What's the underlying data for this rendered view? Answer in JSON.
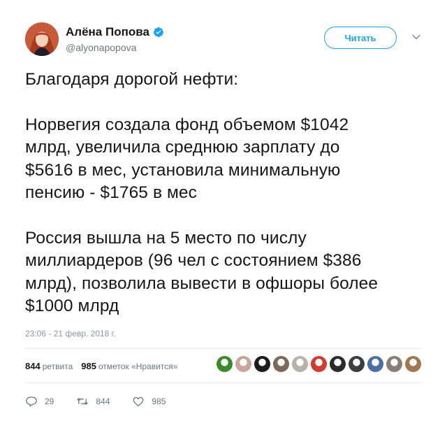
{
  "author": {
    "display_name": "Алёна Попова",
    "handle": "@alyonapopova",
    "verified": true,
    "avatar_icon": "user-avatar"
  },
  "follow_button": {
    "label": "Читать"
  },
  "menu": {
    "icon": "chevron-down-icon"
  },
  "tweet": {
    "paragraphs": [
      "Благодаря дорогой нефти:",
      "Норвегия создала фонд объемом $1042\nмлрд, увеличила среднюю зарплату до\n$5616 в мес, установила минимальную\nпенсию - $1765 в мес",
      "Россия вышла на 5 место по числу\nмиллиардеров (96 чел с состоянием $386\nмлрд), позволила вывести в офшоры более\n$1000 млрд"
    ],
    "timestamp": "23:06 - 21 февр. 2018 г."
  },
  "stats": {
    "retweets_count": "844",
    "retweets_label": "ретвита",
    "likes_count": "985",
    "likes_label": "отметок «Нравится»"
  },
  "likers": [
    {
      "icon": "liker-avatar",
      "color": "#3a8a2a"
    },
    {
      "icon": "liker-avatar",
      "color": "#c9a59a"
    },
    {
      "icon": "liker-avatar",
      "color": "#1c1c1c"
    },
    {
      "icon": "liker-avatar",
      "color": "#7d6a5c"
    },
    {
      "icon": "liker-avatar",
      "color": "#b8b2a8"
    },
    {
      "icon": "liker-avatar",
      "color": "#d43a2f"
    },
    {
      "icon": "liker-avatar",
      "color": "#2b2b2b"
    },
    {
      "icon": "liker-avatar",
      "color": "#3e3e3e"
    },
    {
      "icon": "liker-avatar",
      "color": "#4a6fa5"
    },
    {
      "icon": "liker-avatar",
      "color": "#8a7e74"
    },
    {
      "icon": "liker-avatar",
      "color": "#a0784f"
    }
  ],
  "actions": {
    "reply_count": "29",
    "retweet_count": "844",
    "like_count": "985"
  },
  "colors": {
    "accent": "#1da1f2",
    "text": "#14171a",
    "secondary": "#657786",
    "divider": "#e6ecf0"
  }
}
